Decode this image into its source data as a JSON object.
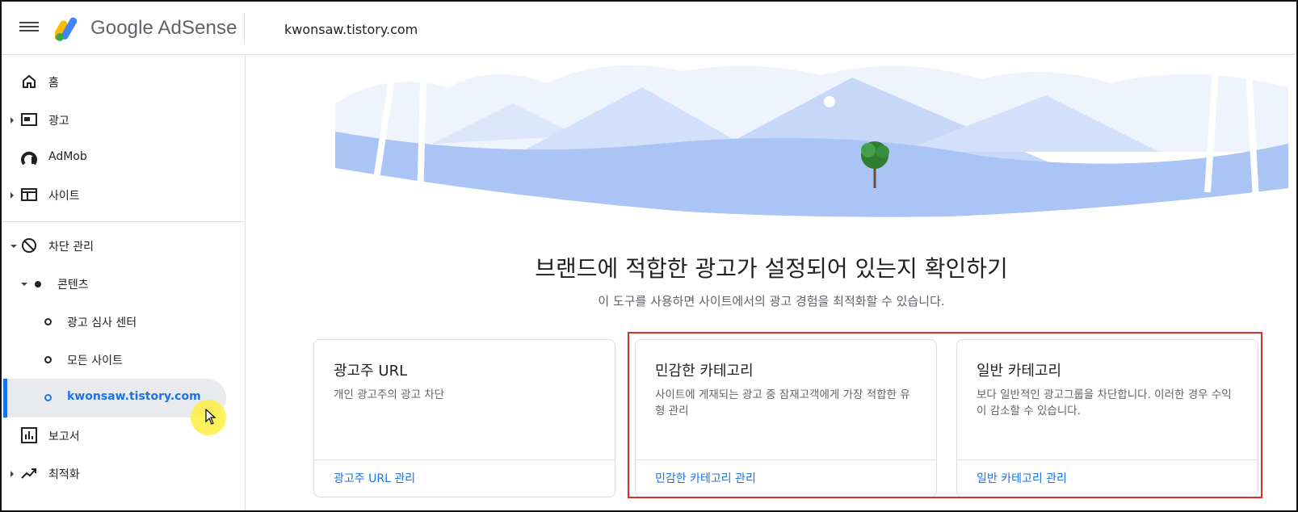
{
  "header": {
    "brand": "Google AdSense",
    "site": "kwonsaw.tistory.com"
  },
  "sidebar": {
    "items": [
      {
        "label": "홈",
        "icon": "home-icon"
      },
      {
        "label": "광고",
        "icon": "ads-icon"
      },
      {
        "label": "AdMob",
        "icon": "admob-icon"
      },
      {
        "label": "사이트",
        "icon": "sites-icon"
      },
      {
        "label": "차단 관리",
        "icon": "block-icon"
      },
      {
        "label": "콘텐츠",
        "icon": "dot-icon"
      },
      {
        "label": "광고 심사 센터",
        "icon": "circle-icon"
      },
      {
        "label": "모든 사이트",
        "icon": "circle-icon"
      },
      {
        "label": "kwonsaw.tistory.com",
        "icon": "circle-icon"
      },
      {
        "label": "보고서",
        "icon": "reports-icon"
      },
      {
        "label": "최적화",
        "icon": "optimize-icon"
      }
    ]
  },
  "main": {
    "headline": "브랜드에 적합한 광고가 설정되어 있는지 확인하기",
    "subline": "이 도구를 사용하면 사이트에서의 광고 경험을 최적화할 수 있습니다.",
    "cards": [
      {
        "title": "광고주 URL",
        "desc": "개인 광고주의 광고 차단",
        "link": "광고주 URL 관리"
      },
      {
        "title": "민감한 카테고리",
        "desc": "사이트에 게재되는 광고 중 잠재고객에게 가장 적합한 유형 관리",
        "link": "민감한 카테고리 관리"
      },
      {
        "title": "일반 카테고리",
        "desc": "보다 일반적인 광고그룹을 차단합니다. 이러한 경우 수익이 감소할 수 있습니다.",
        "link": "일반 카테고리 관리"
      }
    ]
  },
  "colors": {
    "accent": "#1a73e8",
    "highlight_box": "#d93025",
    "cursor_highlight": "#fdf04a"
  }
}
